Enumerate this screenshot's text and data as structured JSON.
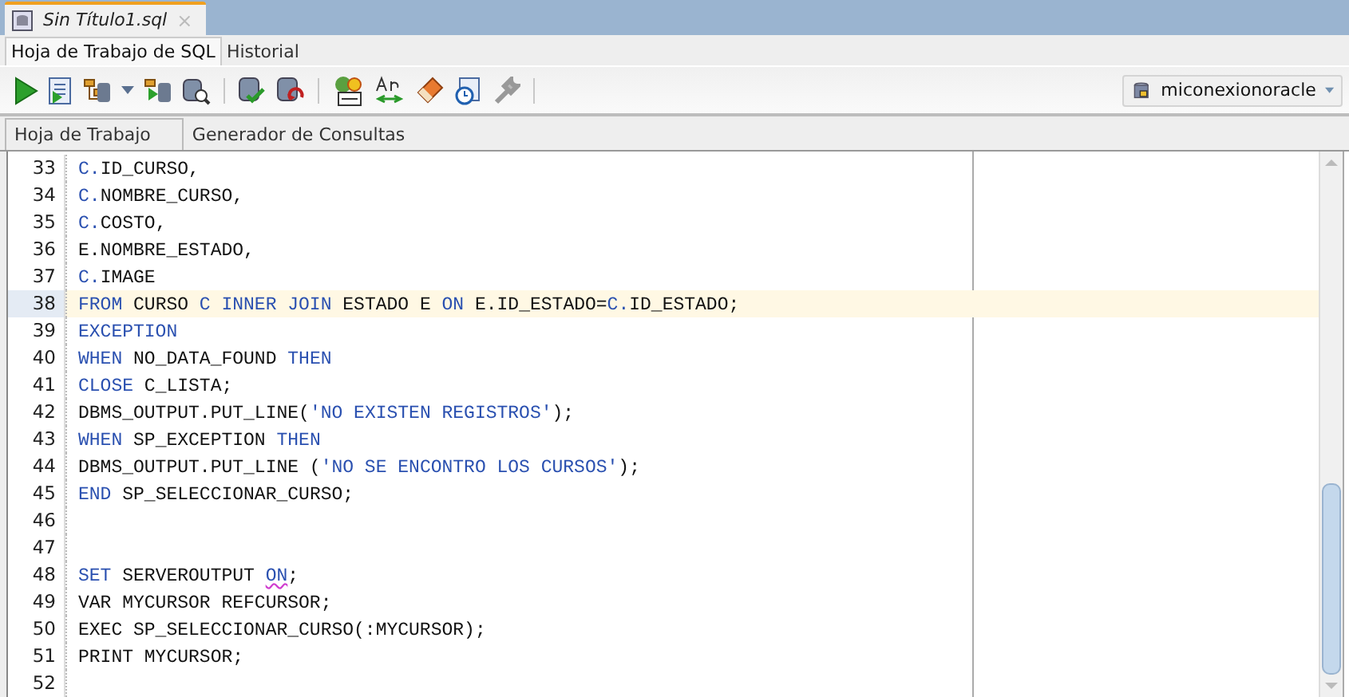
{
  "file_tab": {
    "title": "Sin Título1.sql",
    "close": "×"
  },
  "top_tabs": [
    {
      "label": "Hoja de Trabajo de SQL",
      "selected": true
    },
    {
      "label": "Historial",
      "selected": false
    }
  ],
  "connection": {
    "value": "miconexionoracle"
  },
  "editor_tabs": [
    {
      "label": "Hoja de Trabajo",
      "selected": true
    },
    {
      "label": "Generador de Consultas",
      "selected": false
    }
  ],
  "editor": {
    "lines": [
      {
        "number": "33",
        "current": false,
        "segments": [
          {
            "text": "C.",
            "kind": "kw"
          },
          {
            "text": "ID_CURSO,",
            "kind": "id"
          }
        ]
      },
      {
        "number": "34",
        "current": false,
        "segments": [
          {
            "text": "C.",
            "kind": "kw"
          },
          {
            "text": "NOMBRE_CURSO,",
            "kind": "id"
          }
        ]
      },
      {
        "number": "35",
        "current": false,
        "segments": [
          {
            "text": "C.",
            "kind": "kw"
          },
          {
            "text": "COSTO,",
            "kind": "id"
          }
        ]
      },
      {
        "number": "36",
        "current": false,
        "segments": [
          {
            "text": "E.NOMBRE_ESTADO,",
            "kind": "id"
          }
        ]
      },
      {
        "number": "37",
        "current": false,
        "segments": [
          {
            "text": "C.",
            "kind": "kw"
          },
          {
            "text": "IMAGE",
            "kind": "id"
          }
        ]
      },
      {
        "number": "38",
        "current": true,
        "segments": [
          {
            "text": "FROM",
            "kind": "kw"
          },
          {
            "text": " CURSO ",
            "kind": "id"
          },
          {
            "text": "C INNER JOIN",
            "kind": "kw"
          },
          {
            "text": " ESTADO E ",
            "kind": "id"
          },
          {
            "text": "ON",
            "kind": "kw"
          },
          {
            "text": " E.ID_ESTADO=",
            "kind": "id"
          },
          {
            "text": "C.",
            "kind": "kw"
          },
          {
            "text": "ID_ESTADO;",
            "kind": "id"
          }
        ]
      },
      {
        "number": "39",
        "current": false,
        "segments": [
          {
            "text": "EXCEPTION",
            "kind": "kw"
          }
        ]
      },
      {
        "number": "40",
        "current": false,
        "segments": [
          {
            "text": "WHEN",
            "kind": "kw"
          },
          {
            "text": " NO_DATA_FOUND ",
            "kind": "id"
          },
          {
            "text": "THEN",
            "kind": "kw"
          }
        ]
      },
      {
        "number": "41",
        "current": false,
        "segments": [
          {
            "text": "CLOSE",
            "kind": "kw"
          },
          {
            "text": " C_LISTA;",
            "kind": "id"
          }
        ]
      },
      {
        "number": "42",
        "current": false,
        "segments": [
          {
            "text": "DBMS_OUTPUT.PUT_LINE(",
            "kind": "id"
          },
          {
            "text": "'NO EXISTEN REGISTROS'",
            "kind": "str"
          },
          {
            "text": ");",
            "kind": "id"
          }
        ]
      },
      {
        "number": "43",
        "current": false,
        "segments": [
          {
            "text": "WHEN",
            "kind": "kw"
          },
          {
            "text": " SP_EXCEPTION ",
            "kind": "id"
          },
          {
            "text": "THEN",
            "kind": "kw"
          }
        ]
      },
      {
        "number": "44",
        "current": false,
        "segments": [
          {
            "text": "DBMS_OUTPUT.PUT_LINE (",
            "kind": "id"
          },
          {
            "text": "'NO SE ENCONTRO LOS CURSOS'",
            "kind": "str"
          },
          {
            "text": ");",
            "kind": "id"
          }
        ]
      },
      {
        "number": "45",
        "current": false,
        "segments": [
          {
            "text": "END",
            "kind": "kw"
          },
          {
            "text": " SP_SELECCIONAR_CURSO;",
            "kind": "id"
          }
        ]
      },
      {
        "number": "46",
        "current": false
      },
      {
        "number": "47",
        "current": false
      },
      {
        "number": "48",
        "current": false,
        "segments": [
          {
            "text": "SET",
            "kind": "kw"
          },
          {
            "text": " SERVEROUTPUT ",
            "kind": "id"
          },
          {
            "text": "ON",
            "kind": "flagged"
          },
          {
            "text": ";",
            "kind": "id"
          }
        ]
      },
      {
        "number": "49",
        "current": false,
        "segments": [
          {
            "text": "VAR MYCURSOR REFCURSOR;",
            "kind": "id"
          }
        ]
      },
      {
        "number": "50",
        "current": false,
        "segments": [
          {
            "text": "EXEC SP_SELECCIONAR_CURSO(:MYCURSOR);",
            "kind": "id"
          }
        ]
      },
      {
        "number": "51",
        "current": false,
        "segments": [
          {
            "text": "PRINT MYCURSOR;",
            "kind": "id"
          }
        ]
      },
      {
        "number": "52",
        "current": false
      }
    ]
  }
}
